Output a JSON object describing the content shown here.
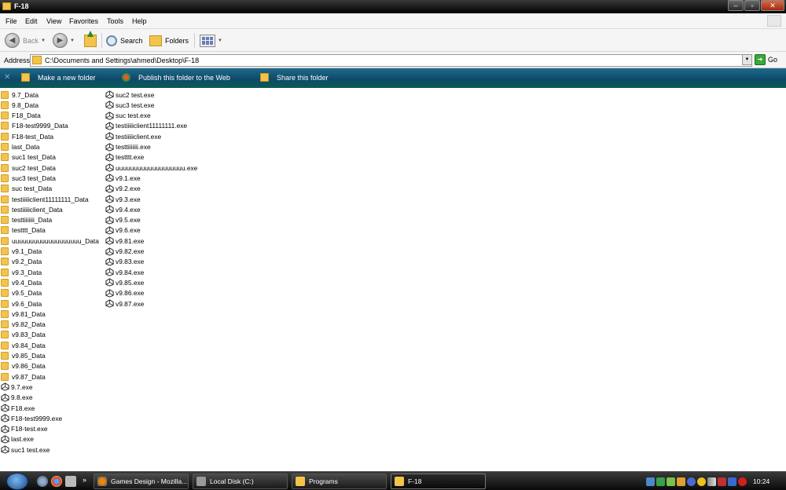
{
  "window": {
    "title": "F-18"
  },
  "menu": [
    "File",
    "Edit",
    "View",
    "Favorites",
    "Tools",
    "Help"
  ],
  "toolbar": {
    "back": "Back",
    "search": "Search",
    "folders": "Folders"
  },
  "address": {
    "label": "Address",
    "path": "C:\\Documents and Settings\\ahmed\\Desktop\\F-18",
    "go": "Go"
  },
  "tasks": [
    "Make a new folder",
    "Publish this folder to the Web",
    "Share this folder"
  ],
  "files_col1": [
    {
      "name": "9.7_Data",
      "type": "folder"
    },
    {
      "name": "9.8_Data",
      "type": "folder"
    },
    {
      "name": "F18_Data",
      "type": "folder"
    },
    {
      "name": "F18-test9999_Data",
      "type": "folder"
    },
    {
      "name": "F18-test_Data",
      "type": "folder"
    },
    {
      "name": "last_Data",
      "type": "folder"
    },
    {
      "name": "suc1 test_Data",
      "type": "folder"
    },
    {
      "name": "suc2 test_Data",
      "type": "folder"
    },
    {
      "name": "suc3 test_Data",
      "type": "folder"
    },
    {
      "name": "suc test_Data",
      "type": "folder"
    },
    {
      "name": "testiiiiiclient11111111_Data",
      "type": "folder"
    },
    {
      "name": "testiiiiiclient_Data",
      "type": "folder"
    },
    {
      "name": "testtiiiiiii_Data",
      "type": "folder"
    },
    {
      "name": "testttt_Data",
      "type": "folder"
    },
    {
      "name": "uuuuuuuuuuuuuuuuuuu_Data",
      "type": "folder"
    },
    {
      "name": "v9.1_Data",
      "type": "folder"
    },
    {
      "name": "v9.2_Data",
      "type": "folder"
    },
    {
      "name": "v9.3_Data",
      "type": "folder"
    },
    {
      "name": "v9.4_Data",
      "type": "folder"
    },
    {
      "name": "v9.5_Data",
      "type": "folder"
    },
    {
      "name": "v9.6_Data",
      "type": "folder"
    },
    {
      "name": "v9.81_Data",
      "type": "folder"
    },
    {
      "name": "v9.82_Data",
      "type": "folder"
    },
    {
      "name": "v9.83_Data",
      "type": "folder"
    },
    {
      "name": "v9.84_Data",
      "type": "folder"
    },
    {
      "name": "v9.85_Data",
      "type": "folder"
    },
    {
      "name": "v9.86_Data",
      "type": "folder"
    },
    {
      "name": "v9.87_Data",
      "type": "folder"
    },
    {
      "name": "9.7.exe",
      "type": "exe"
    },
    {
      "name": "9.8.exe",
      "type": "exe"
    },
    {
      "name": "F18.exe",
      "type": "exe"
    },
    {
      "name": "F18-test9999.exe",
      "type": "exe"
    },
    {
      "name": "F18-test.exe",
      "type": "exe"
    },
    {
      "name": "last.exe",
      "type": "exe"
    },
    {
      "name": "suc1 test.exe",
      "type": "exe"
    }
  ],
  "files_col2": [
    {
      "name": "suc2 test.exe",
      "type": "exe"
    },
    {
      "name": "suc3 test.exe",
      "type": "exe"
    },
    {
      "name": "suc test.exe",
      "type": "exe"
    },
    {
      "name": "testiiiiiclient11111111.exe",
      "type": "exe"
    },
    {
      "name": "testiiiiiclient.exe",
      "type": "exe"
    },
    {
      "name": "testtiiiiiii.exe",
      "type": "exe"
    },
    {
      "name": "testttt.exe",
      "type": "exe"
    },
    {
      "name": "uuuuuuuuuuuuuuuuuuu.exe",
      "type": "exe"
    },
    {
      "name": "v9.1.exe",
      "type": "exe"
    },
    {
      "name": "v9.2.exe",
      "type": "exe"
    },
    {
      "name": "v9.3.exe",
      "type": "exe"
    },
    {
      "name": "v9.4.exe",
      "type": "exe"
    },
    {
      "name": "v9.5.exe",
      "type": "exe"
    },
    {
      "name": "v9.6.exe",
      "type": "exe"
    },
    {
      "name": "v9.81.exe",
      "type": "exe"
    },
    {
      "name": "v9.82.exe",
      "type": "exe"
    },
    {
      "name": "v9.83.exe",
      "type": "exe"
    },
    {
      "name": "v9.84.exe",
      "type": "exe"
    },
    {
      "name": "v9.85.exe",
      "type": "exe"
    },
    {
      "name": "v9.86.exe",
      "type": "exe"
    },
    {
      "name": "v9.87.exe",
      "type": "exe"
    }
  ],
  "taskbar": {
    "chevron": "»",
    "buttons": [
      "Games Design - Mozilla...",
      "Local Disk (C:)",
      "Programs",
      "F-18"
    ],
    "clock": "10:24"
  },
  "colors": {
    "folder": "#f3c34b",
    "taskpane": "#0e4a6a",
    "taskbar": "#1a1a1a"
  }
}
